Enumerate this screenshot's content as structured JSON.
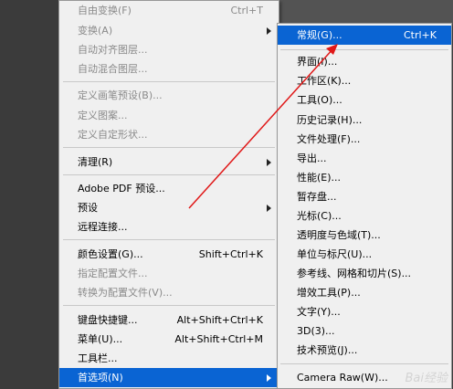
{
  "edit_menu": {
    "items": [
      {
        "label": "自由变换(F)",
        "shortcut": "Ctrl+T",
        "disabled": true
      },
      {
        "label": "变换(A)",
        "disabled": true,
        "submenu": true
      },
      {
        "label": "自动对齐图层...",
        "disabled": true
      },
      {
        "label": "自动混合图层...",
        "disabled": true
      },
      {
        "label": "定义画笔预设(B)...",
        "disabled": true
      },
      {
        "label": "定义图案...",
        "disabled": true
      },
      {
        "label": "定义自定形状...",
        "disabled": true
      },
      {
        "label": "清理(R)",
        "submenu": true
      },
      {
        "label": "Adobe PDF 预设..."
      },
      {
        "label": "预设",
        "submenu": true
      },
      {
        "label": "远程连接..."
      },
      {
        "label": "颜色设置(G)...",
        "shortcut": "Shift+Ctrl+K"
      },
      {
        "label": "指定配置文件...",
        "disabled": true
      },
      {
        "label": "转换为配置文件(V)...",
        "disabled": true
      },
      {
        "label": "键盘快捷键...",
        "shortcut": "Alt+Shift+Ctrl+K"
      },
      {
        "label": "菜单(U)...",
        "shortcut": "Alt+Shift+Ctrl+M"
      },
      {
        "label": "工具栏..."
      },
      {
        "label": "首选项(N)",
        "submenu": true,
        "selected": true
      }
    ]
  },
  "prefs_menu": {
    "items": [
      {
        "label": "常规(G)...",
        "shortcut": "Ctrl+K",
        "selected": true
      },
      {
        "label": "界面(I)..."
      },
      {
        "label": "工作区(K)..."
      },
      {
        "label": "工具(O)..."
      },
      {
        "label": "历史记录(H)..."
      },
      {
        "label": "文件处理(F)..."
      },
      {
        "label": "导出..."
      },
      {
        "label": "性能(E)..."
      },
      {
        "label": "暂存盘..."
      },
      {
        "label": "光标(C)..."
      },
      {
        "label": "透明度与色域(T)..."
      },
      {
        "label": "单位与标尺(U)..."
      },
      {
        "label": "参考线、网格和切片(S)..."
      },
      {
        "label": "增效工具(P)..."
      },
      {
        "label": "文字(Y)..."
      },
      {
        "label": "3D(3)..."
      },
      {
        "label": "技术预览(J)..."
      },
      {
        "label": "Camera Raw(W)..."
      }
    ]
  },
  "annotation_color": "#e01818",
  "watermark": "Bai经验"
}
